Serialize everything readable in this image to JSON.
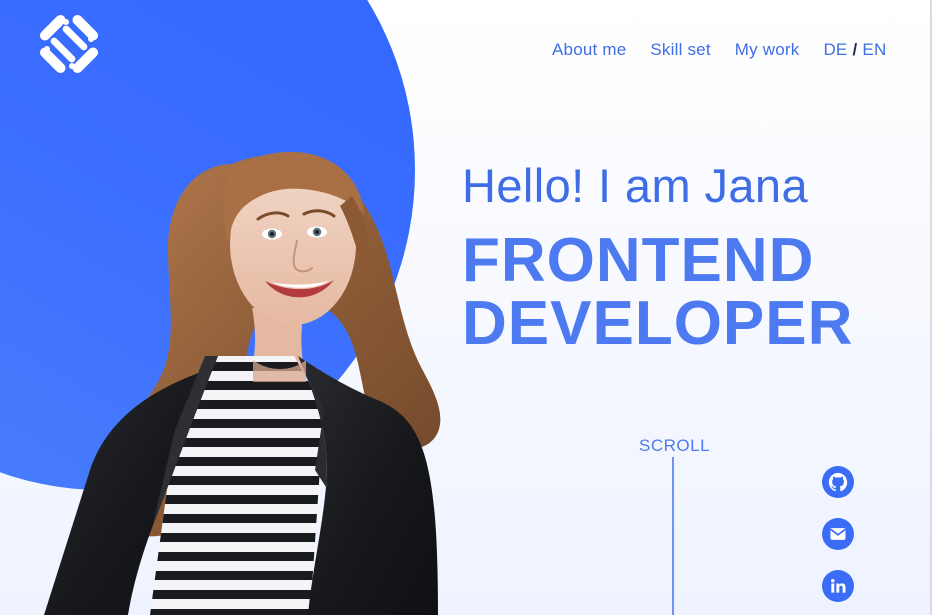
{
  "nav": {
    "items": [
      {
        "label": "About me"
      },
      {
        "label": "Skill set"
      },
      {
        "label": "My work"
      }
    ],
    "lang_de": "DE",
    "lang_sep": "/",
    "lang_en": "EN"
  },
  "hero": {
    "greeting": "Hello! I am Jana",
    "title_line1": "FRONTEND",
    "title_line2": "DEVELOPER"
  },
  "scroll": {
    "label": "SCROLL"
  },
  "social": {
    "github_icon": "github-icon",
    "mail_icon": "mail-icon",
    "linkedin_icon": "linkedin-icon"
  },
  "colors": {
    "brand_blue": "#3f6de6",
    "blob_blue": "#2f64ff",
    "title_blue": "#4d7af0"
  }
}
